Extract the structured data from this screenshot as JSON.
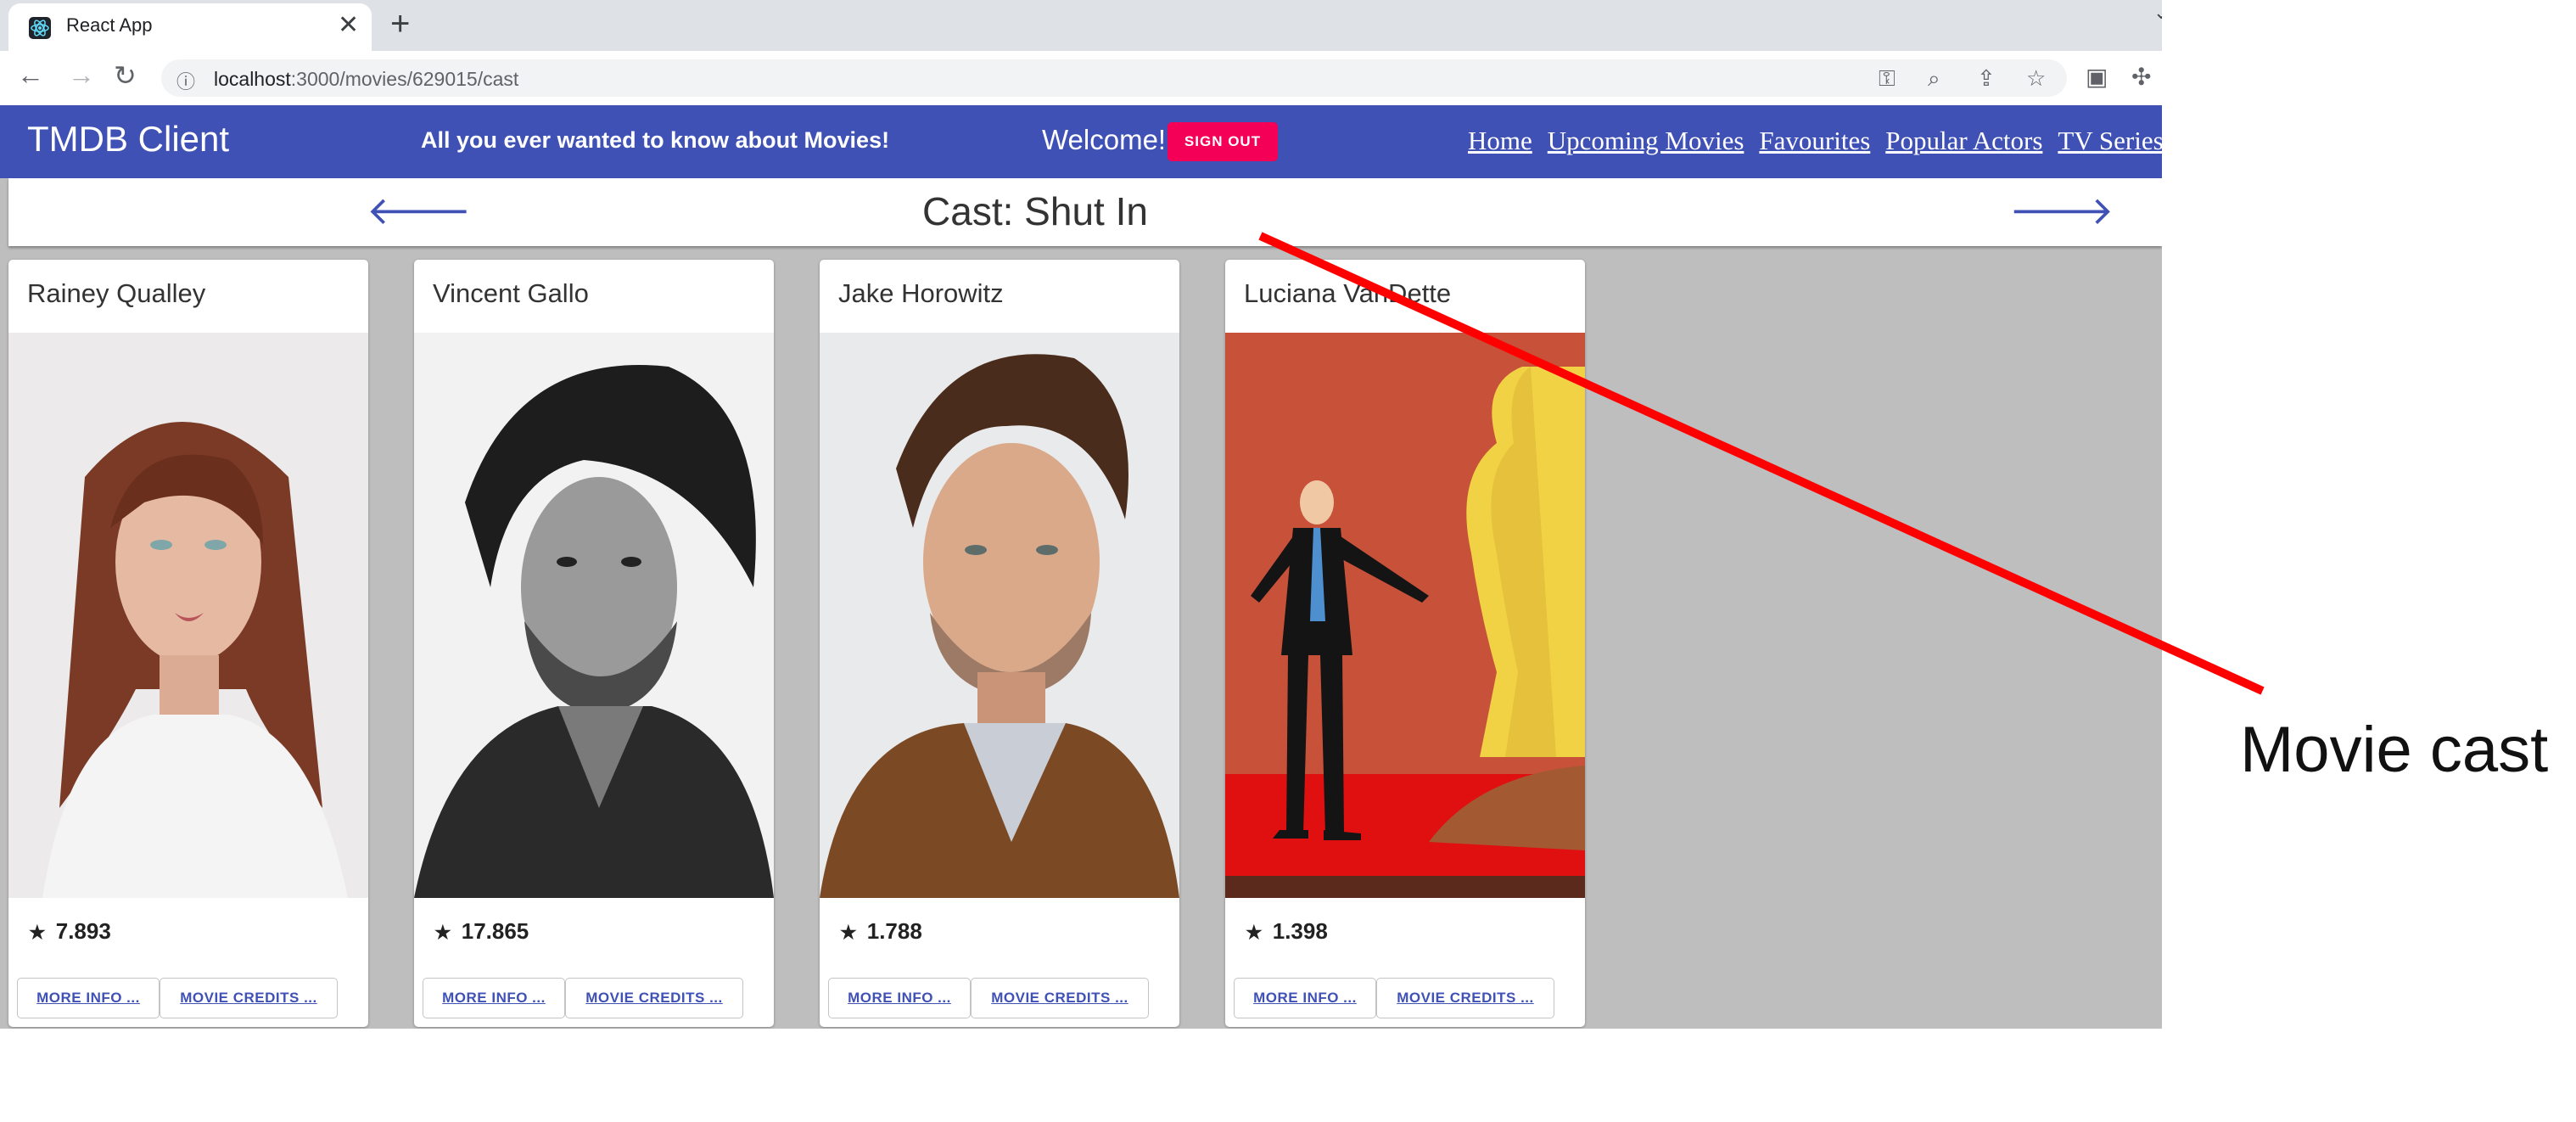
{
  "browser": {
    "tab_title": "React App",
    "close_glyph": "✕",
    "newtab_glyph": "+",
    "url_host": "localhost",
    "url_path": ":3000/movies/629015/cast"
  },
  "app": {
    "brand": "TMDB Client",
    "tagline": "All you ever wanted to know about Movies!",
    "welcome": "Welcome!",
    "signout_label": "Sign Out",
    "menu": [
      "Home",
      "Upcoming Movies",
      "Favourites",
      "Popular Actors",
      "TV Series"
    ]
  },
  "header": {
    "title": "Cast: Shut In",
    "back_icon": "arrow-back-icon",
    "forward_icon": "arrow-forward-icon"
  },
  "cast": [
    {
      "name": "Rainey Qualley",
      "rating": "7.893",
      "more_info": "MORE INFO ...",
      "credits": "MOVIE CREDITS ..."
    },
    {
      "name": "Vincent Gallo",
      "rating": "17.865",
      "more_info": "MORE INFO ...",
      "credits": "MOVIE CREDITS ..."
    },
    {
      "name": "Jake Horowitz",
      "rating": "1.788",
      "more_info": "MORE INFO ...",
      "credits": "MOVIE CREDITS ..."
    },
    {
      "name": "Luciana VanDette",
      "rating": "1.398",
      "more_info": "MORE INFO ...",
      "credits": "MOVIE CREDITS ..."
    }
  ],
  "annotation": {
    "text": "Movie cast",
    "color": "#ff0000"
  },
  "colors": {
    "appbar": "#3f51b5",
    "signout": "#f50057",
    "background": "#bebebe"
  }
}
